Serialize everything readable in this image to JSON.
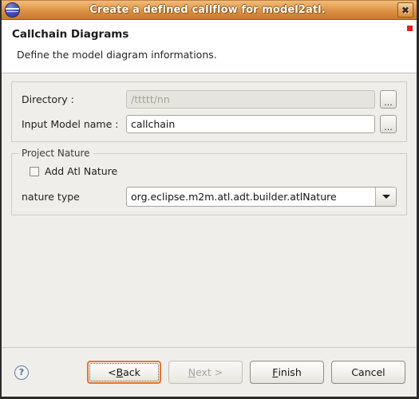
{
  "window": {
    "title": "Create a defined callflow for model2atl.",
    "icon": "eclipse-globe-icon",
    "close_label": "✖"
  },
  "header": {
    "title": "Callchain Diagrams",
    "description": "Define the model diagram informations.",
    "marker_color": "#e71d1d"
  },
  "form": {
    "directory": {
      "label": "Directory :",
      "value": "/ttttt/nn",
      "enabled": false,
      "browse_label": "..."
    },
    "input_model": {
      "label": "Input Model name :",
      "value": "callchain",
      "placeholder": "",
      "enabled": true,
      "browse_label": "..."
    }
  },
  "project_nature": {
    "group_title": "Project Nature",
    "checkbox": {
      "label": "Add Atl Nature",
      "checked": false
    },
    "nature_type": {
      "label": "nature type",
      "value": "org.eclipse.m2m.atl.adt.builder.atlNature",
      "options": [
        "org.eclipse.m2m.atl.adt.builder.atlNature"
      ]
    }
  },
  "footer": {
    "help_label": "?",
    "buttons": [
      {
        "id": "back",
        "label_prefix": "< ",
        "mnemonic": "B",
        "label_suffix": "ack",
        "state": "focused"
      },
      {
        "id": "next",
        "label_prefix": "",
        "mnemonic": "N",
        "label_suffix": "ext >",
        "state": "disabled"
      },
      {
        "id": "finish",
        "label_prefix": "",
        "mnemonic": "F",
        "label_suffix": "inish",
        "state": "normal"
      },
      {
        "id": "cancel",
        "label_prefix": "",
        "mnemonic": "",
        "label_suffix": "Cancel",
        "state": "normal"
      }
    ]
  },
  "colors": {
    "titlebar_accent": "#d98c3e",
    "focus_ring": "#e8762a",
    "dialog_bg": "#efeeea",
    "header_bg": "#ffffff"
  }
}
